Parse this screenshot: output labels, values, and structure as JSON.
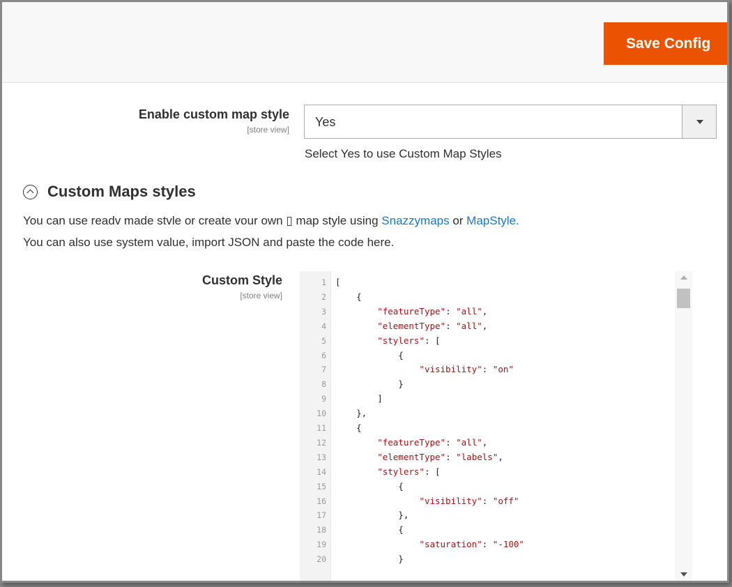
{
  "header": {
    "save_label": "Save Config"
  },
  "enable_field": {
    "label": "Enable custom map style",
    "scope": "[store view]",
    "value": "Yes",
    "note": "Select Yes to use Custom Map Styles"
  },
  "section": {
    "title": "Custom Maps styles",
    "desc_part1": "You can use readv made stvle or create vour own ▯ map style using ",
    "link1": "Snazzymaps",
    "desc_or": " or ",
    "link2": "MapStyle.",
    "desc_line2": " You can also use system value, import JSON and paste the code here."
  },
  "custom_style": {
    "label": "Custom Style",
    "scope": "[store view]",
    "lines": [
      "[",
      "    {",
      "        \"featureType\": \"all\",",
      "        \"elementType\": \"all\",",
      "        \"stylers\": [",
      "            {",
      "                \"visibility\": \"on\"",
      "            }",
      "        ]",
      "    },",
      "    {",
      "        \"featureType\": \"all\",",
      "        \"elementType\": \"labels\",",
      "        \"stylers\": [",
      "            {",
      "                \"visibility\": \"off\"",
      "            },",
      "            {",
      "                \"saturation\": \"-100\"",
      "            }"
    ]
  },
  "colors": {
    "accent": "#eb5202",
    "link": "#1979c3",
    "string": "#a31515"
  }
}
